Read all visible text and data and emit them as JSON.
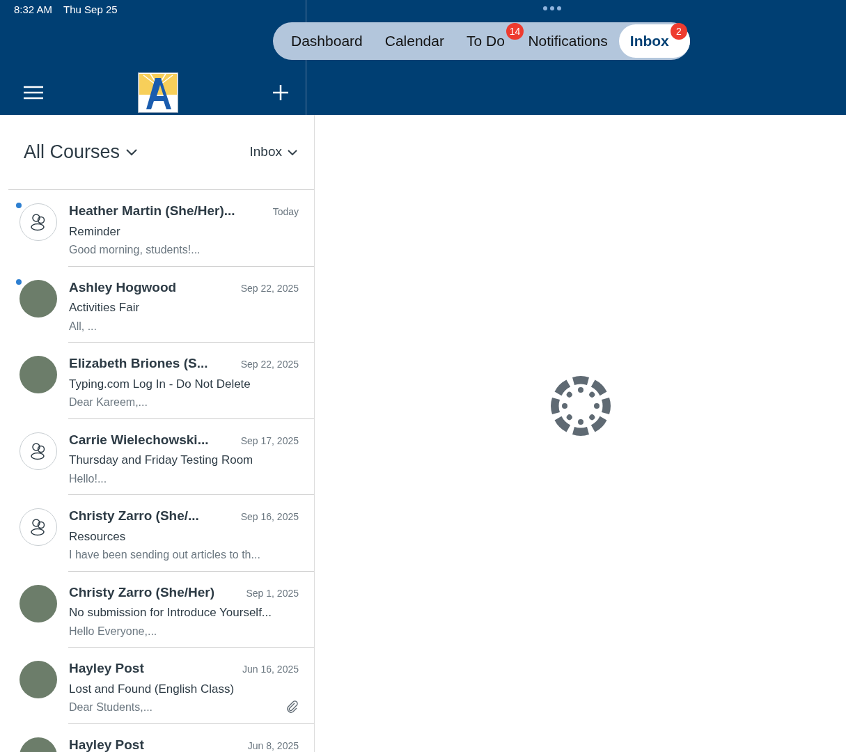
{
  "status_bar": {
    "time": "8:32 AM",
    "date": "Thu Sep 25"
  },
  "tabs": [
    {
      "label": "Dashboard",
      "selected": false
    },
    {
      "label": "Calendar",
      "selected": false
    },
    {
      "label": "To Do",
      "selected": false,
      "badge": "14"
    },
    {
      "label": "Notifications",
      "selected": false
    },
    {
      "label": "Inbox",
      "selected": true,
      "badge": "2"
    }
  ],
  "sidebar": {
    "course_filter": "All Courses",
    "folder_filter": "Inbox"
  },
  "messages": [
    {
      "sender": "Heather Martin (She/Her)...",
      "date": "Today",
      "subject": "Reminder",
      "preview": "Good morning, students!...",
      "kind": "group",
      "unread": true,
      "attachment": false
    },
    {
      "sender": "Ashley Hogwood",
      "date": "Sep 22, 2025",
      "subject": "Activities Fair",
      "preview": "All, ...",
      "kind": "photo",
      "unread": true,
      "attachment": false
    },
    {
      "sender": "Elizabeth Briones (S...",
      "date": "Sep 22, 2025",
      "subject": "Typing.com Log In - Do Not Delete",
      "preview": "Dear Kareem,...",
      "kind": "photo",
      "unread": false,
      "attachment": false
    },
    {
      "sender": "Carrie Wielechowski...",
      "date": "Sep 17, 2025",
      "subject": "Thursday and Friday Testing Room",
      "preview": "Hello!...",
      "kind": "group",
      "unread": false,
      "attachment": false
    },
    {
      "sender": "Christy Zarro (She/...",
      "date": "Sep 16, 2025",
      "subject": "Resources",
      "preview": "I have been sending out articles to th...",
      "kind": "group",
      "unread": false,
      "attachment": false
    },
    {
      "sender": "Christy Zarro (She/Her)",
      "date": "Sep 1, 2025",
      "subject": "No submission for Introduce Yourself...",
      "preview": "Hello Everyone,...",
      "kind": "photo",
      "unread": false,
      "attachment": false
    },
    {
      "sender": "Hayley Post",
      "date": "Jun 16, 2025",
      "subject": "Lost and Found (English Class)",
      "preview": "Dear Students,...",
      "kind": "photo",
      "unread": false,
      "attachment": true
    },
    {
      "sender": "Hayley Post",
      "date": "Jun 8, 2025",
      "kind": "photo",
      "unread": false,
      "attachment": false
    }
  ]
}
